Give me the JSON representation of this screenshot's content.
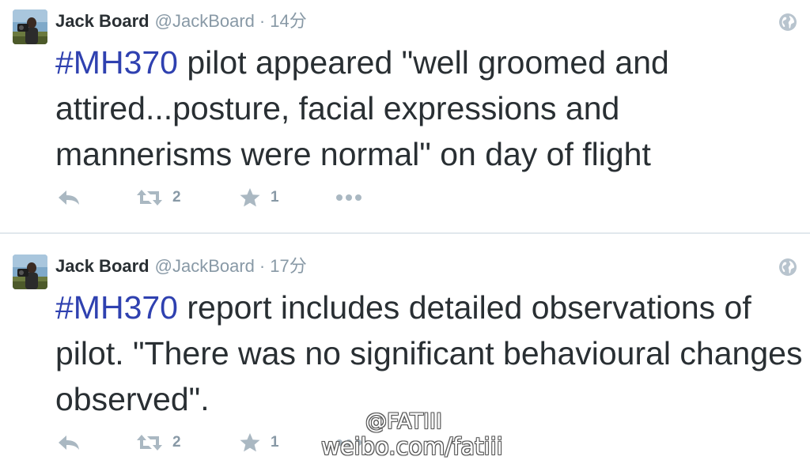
{
  "tweets": [
    {
      "name": "Jack Board",
      "handle": "@JackBoard",
      "separator": "·",
      "time": "14分",
      "hashtag": "#MH370",
      "text": " pilot appeared \"well groomed and attired...posture, facial expressions and mannerisms were normal\" on day of flight",
      "retweets": "2",
      "favorites": "1"
    },
    {
      "name": "Jack Board",
      "handle": "@JackBoard",
      "separator": "·",
      "time": "17分",
      "hashtag": "#MH370",
      "text": " report includes detailed observations of pilot. \"There was no significant behavioural changes observed\".",
      "retweets": "2",
      "favorites": "1"
    }
  ],
  "watermark": {
    "line1": "@FATIII",
    "line2": "weibo.com/fatiii"
  },
  "colors": {
    "hashtag": "#2f41b0",
    "text": "#292f33",
    "meta": "#8899a6",
    "icon": "#aab8c2",
    "divider": "#e1e8ed"
  },
  "icons": [
    "avatar-photo",
    "globe-icon",
    "reply-icon",
    "retweet-icon",
    "star-icon",
    "more-icon"
  ]
}
